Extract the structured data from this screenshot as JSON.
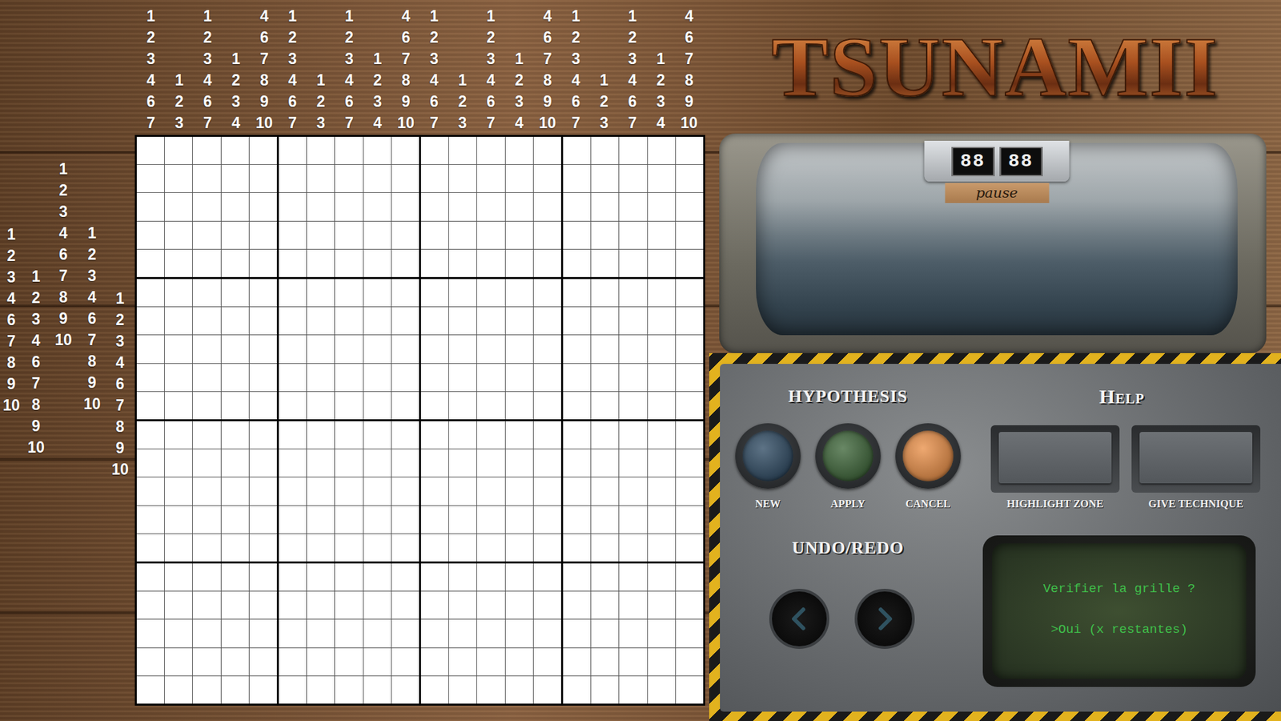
{
  "title": "TSUNAMII",
  "column_clues": [
    [
      "1",
      "2",
      "3",
      "4",
      "6",
      "7"
    ],
    [
      "1",
      "2",
      "3"
    ],
    [
      "1",
      "2",
      "3",
      "4",
      "6",
      "7"
    ],
    [
      "1",
      "2",
      "3",
      "4"
    ],
    [
      "4",
      "6",
      "7",
      "8",
      "9",
      "10"
    ],
    [
      "1",
      "2",
      "3",
      "4",
      "6",
      "7"
    ],
    [
      "1",
      "2",
      "3"
    ],
    [
      "1",
      "2",
      "3",
      "4",
      "6",
      "7"
    ],
    [
      "1",
      "2",
      "3",
      "4"
    ],
    [
      "4",
      "6",
      "7",
      "8",
      "9",
      "10"
    ],
    [
      "1",
      "2",
      "3",
      "4",
      "6",
      "7"
    ],
    [
      "1",
      "2",
      "3"
    ],
    [
      "1",
      "2",
      "3",
      "4",
      "6",
      "7"
    ],
    [
      "1",
      "2",
      "3",
      "4"
    ],
    [
      "4",
      "6",
      "7",
      "8",
      "9",
      "10"
    ],
    [
      "1",
      "2",
      "3",
      "4",
      "6",
      "7"
    ],
    [
      "1",
      "2",
      "3"
    ],
    [
      "1",
      "2",
      "3",
      "4",
      "6",
      "7"
    ],
    [
      "1",
      "2",
      "3",
      "4"
    ],
    [
      "4",
      "6",
      "7",
      "8",
      "9",
      "10"
    ]
  ],
  "row_clues": [
    [
      "1",
      "2",
      "3",
      "4",
      "6",
      "7",
      "8",
      "9",
      "10"
    ],
    [
      "1",
      "2",
      "3",
      "4",
      "6",
      "7",
      "8",
      "9",
      "10"
    ],
    [
      "1",
      "2",
      "3",
      "4",
      "6",
      "7",
      "8",
      "9",
      "10"
    ],
    [
      "1",
      "2",
      "3",
      "4",
      "6",
      "7",
      "8",
      "9",
      "10"
    ],
    [
      "1",
      "2",
      "3",
      "4",
      "6",
      "7",
      "8",
      "9",
      "10"
    ]
  ],
  "board": {
    "rows": 20,
    "columns": 20
  },
  "timer": {
    "minutes": "88",
    "seconds": "88",
    "pause": "pause"
  },
  "hypothesis": {
    "title": "HYPOTHESIS",
    "buttons": [
      {
        "label": "NEW",
        "color": "#1f3d57"
      },
      {
        "label": "APPLY",
        "color": "#2f5a2a"
      },
      {
        "label": "CANCEL",
        "color": "#e8873a"
      }
    ]
  },
  "help": {
    "title": "Help",
    "buttons": [
      "HIGHLIGHT ZONE",
      "GIVE TECHNIQUE"
    ]
  },
  "undo_redo": {
    "title": "UNDO/REDO",
    "buttons": [
      {
        "kind": "back"
      },
      {
        "kind": "forward"
      }
    ]
  },
  "console": {
    "lines": [
      "Verifier la grille ?",
      ">Oui (x restantes)"
    ]
  }
}
